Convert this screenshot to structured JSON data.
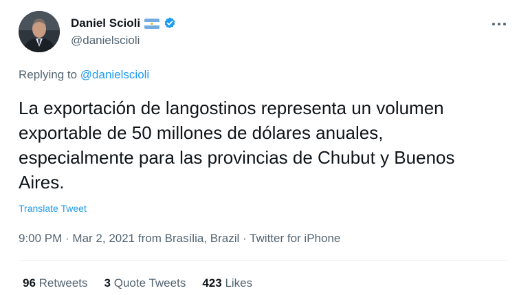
{
  "author": {
    "name": "Daniel Scioli",
    "handle": "@danielscioli"
  },
  "reply": {
    "prefix": "Replying to ",
    "to": "@danielscioli"
  },
  "tweet": {
    "text": "La exportación de langostinos representa un volumen exportable de 50 millones de dólares anuales, especialmente para las provincias de Chubut y Buenos Aires.",
    "translate_label": "Translate Tweet"
  },
  "meta": {
    "time": "9:00 PM",
    "date": "Mar 2, 2021",
    "location_prefix": "from ",
    "location": "Brasília, Brazil",
    "source": "Twitter for iPhone",
    "separator": " · "
  },
  "stats": {
    "retweets_count": "96",
    "retweets_label": "Retweets",
    "quotes_count": "3",
    "quotes_label": "Quote Tweets",
    "likes_count": "423",
    "likes_label": "Likes"
  },
  "icons": {
    "verified": "verified-badge-icon",
    "flag": "argentina-flag-icon",
    "more": "more-options-icon"
  },
  "colors": {
    "accent": "#1d9bf0",
    "secondary_text": "#536471",
    "primary_text": "#0f1419",
    "flag_blue": "#74acdf",
    "flag_sun": "#f6b40e"
  }
}
